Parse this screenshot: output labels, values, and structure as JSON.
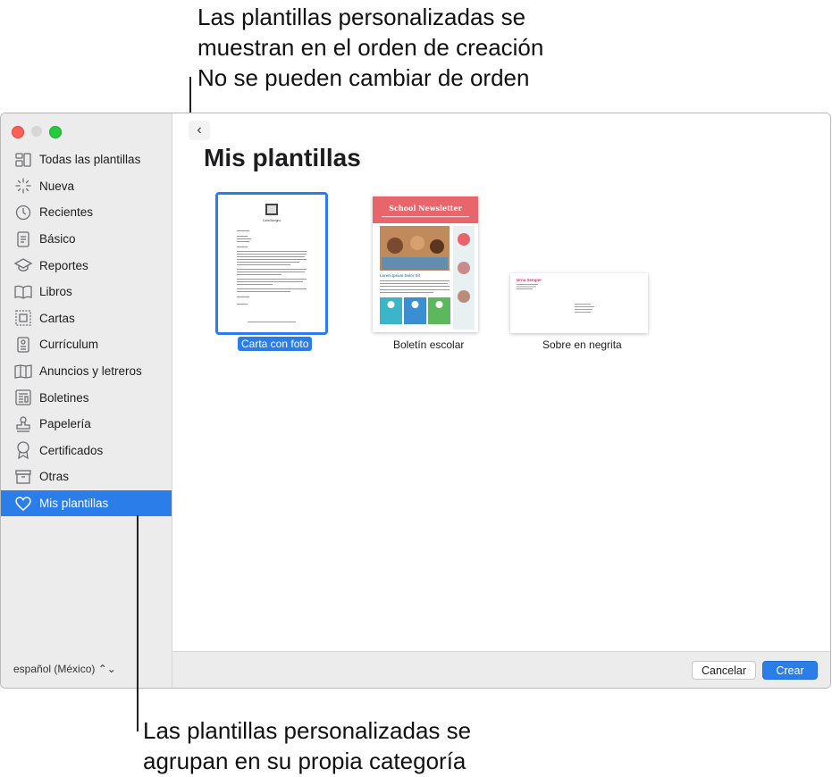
{
  "callouts": {
    "top": [
      "Las plantillas personalizadas se",
      "muestran en el orden de creación",
      "No se pueden cambiar de orden"
    ],
    "bottom": [
      "Las plantillas personalizadas se",
      "agrupan en su propia categoría"
    ]
  },
  "sidebar": {
    "items": [
      {
        "label": "Todas las plantillas",
        "icon": "grid-icon"
      },
      {
        "label": "Nueva",
        "icon": "sparkle-icon"
      },
      {
        "label": "Recientes",
        "icon": "clock-icon"
      },
      {
        "label": "Básico",
        "icon": "document-icon"
      },
      {
        "label": "Reportes",
        "icon": "graduation-cap-icon"
      },
      {
        "label": "Libros",
        "icon": "book-icon"
      },
      {
        "label": "Cartas",
        "icon": "envelope-frame-icon"
      },
      {
        "label": "Currículum",
        "icon": "id-card-icon"
      },
      {
        "label": "Anuncios y letreros",
        "icon": "map-icon"
      },
      {
        "label": "Boletines",
        "icon": "newspaper-icon"
      },
      {
        "label": "Papelería",
        "icon": "stamp-icon"
      },
      {
        "label": "Certificados",
        "icon": "ribbon-icon"
      },
      {
        "label": "Otras",
        "icon": "archive-box-icon"
      },
      {
        "label": "Mis plantillas",
        "icon": "heart-icon",
        "selected": true
      }
    ],
    "language": "español (México)"
  },
  "main": {
    "back_label": "‹",
    "title": "Mis plantillas",
    "templates": [
      {
        "caption": "Carta con foto",
        "selected": true
      },
      {
        "caption": "Boletín escolar"
      },
      {
        "caption": "Sobre en negrita"
      }
    ],
    "newsletter": {
      "title": "School Newsletter",
      "heading": "Lorem Ipsum Dolor Sit"
    },
    "envelope": {
      "name": "Urna Semper"
    },
    "letter": {
      "name": "Carla Benigno"
    }
  },
  "footer": {
    "cancel_label": "Cancelar",
    "create_label": "Crear"
  },
  "colors": {
    "accent": "#2b7de9",
    "newsletter_red": "#e8656b",
    "newsletter_teal": "#3bb6c9",
    "envelope_pink": "#d6336c"
  }
}
